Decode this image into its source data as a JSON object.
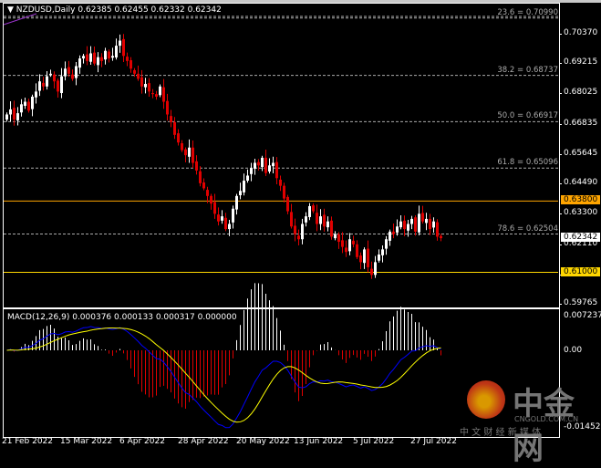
{
  "header": {
    "symbol_label": "NZDUSD,Daily",
    "ohlc": "0.62385 0.62455 0.62332 0.62342"
  },
  "macd": {
    "label": "MACD(12,26,9) 0.000376 0.000133 0.000317 0.000000",
    "axis": [
      "0.007237",
      "0.00",
      "-0.014529"
    ],
    "axis_values": [
      0.007237,
      0,
      -0.014529
    ]
  },
  "price_axis": {
    "labels": [
      "0.70370",
      "0.69215",
      "0.68025",
      "0.66835",
      "0.65645",
      "0.64490",
      "0.63300",
      "0.62110",
      "0.60920",
      "0.59765"
    ],
    "range": [
      0.59765,
      0.7037
    ]
  },
  "levels": {
    "current": "0.62342",
    "line_6380": "0.63800",
    "line_6100": "0.61000",
    "current_value": 0.62342,
    "line_6380_value": 0.638,
    "line_6100_value": 0.61
  },
  "fib": [
    {
      "label": "23.6 = 0.70990",
      "value": 0.7099
    },
    {
      "label": "38.2 = 0.68737",
      "value": 0.68737
    },
    {
      "label": "50.0 = 0.66917",
      "value": 0.66917
    },
    {
      "label": "61.8 = 0.65096",
      "value": 0.65096
    },
    {
      "label": "78.6 = 0.62504",
      "value": 0.62504
    }
  ],
  "dates": [
    "21 Feb 2022",
    "15 Mar 2022",
    "6 Apr 2022",
    "28 Apr 2022",
    "20 May 2022",
    "13 Jun 2022",
    "5 Jul 2022",
    "27 Jul 2022"
  ],
  "colors": {
    "bull": "#ffffff",
    "bear": "#e00000",
    "macd_line": "#0000ff",
    "signal_line": "#ffff00",
    "level_line": "#ffa500",
    "fib": "#aaaaaa"
  },
  "chart_data": {
    "type": "candlestick",
    "closes": [
      0.672,
      0.674,
      0.67,
      0.6725,
      0.676,
      0.677,
      0.6735,
      0.679,
      0.681,
      0.685,
      0.683,
      0.687,
      0.688,
      0.685,
      0.681,
      0.687,
      0.69,
      0.688,
      0.686,
      0.691,
      0.694,
      0.695,
      0.693,
      0.696,
      0.692,
      0.6945,
      0.693,
      0.697,
      0.694,
      0.695,
      0.699,
      0.701,
      0.695,
      0.693,
      0.69,
      0.688,
      0.686,
      0.683,
      0.684,
      0.681,
      0.68,
      0.679,
      0.683,
      0.677,
      0.672,
      0.669,
      0.664,
      0.661,
      0.658,
      0.656,
      0.659,
      0.653,
      0.65,
      0.645,
      0.643,
      0.64,
      0.637,
      0.633,
      0.63,
      0.632,
      0.627,
      0.629,
      0.635,
      0.64,
      0.642,
      0.646,
      0.648,
      0.651,
      0.653,
      0.652,
      0.655,
      0.649,
      0.652,
      0.653,
      0.647,
      0.644,
      0.639,
      0.634,
      0.628,
      0.625,
      0.623,
      0.629,
      0.632,
      0.636,
      0.634,
      0.629,
      0.632,
      0.628,
      0.63,
      0.624,
      0.625,
      0.622,
      0.62,
      0.618,
      0.623,
      0.621,
      0.616,
      0.614,
      0.619,
      0.612,
      0.609,
      0.614,
      0.617,
      0.619,
      0.623,
      0.626,
      0.625,
      0.628,
      0.63,
      0.627,
      0.629,
      0.631,
      0.626,
      0.633,
      0.63,
      0.631,
      0.627,
      0.63,
      0.624,
      0.62342
    ]
  },
  "watermark": {
    "brand": "中金网",
    "url": "CNGOLD.COM.CN",
    "tagline": "中 文 财 经 新 媒 体"
  }
}
